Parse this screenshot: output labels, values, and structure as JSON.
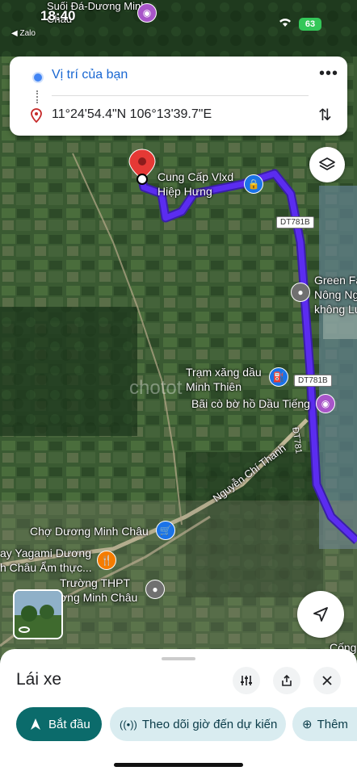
{
  "status_bar": {
    "time": "18:40",
    "back_app": "◀ Zalo",
    "battery": "63"
  },
  "route": {
    "from": "Vị trí của bạn",
    "to": "11°24'54.4\"N 106°13'39.7\"E",
    "more_icon": "more-dots-icon",
    "swap_icon": "swap-icon"
  },
  "map": {
    "places": {
      "top_poi": "Suối Đá-Dương Minh Châu",
      "destination": "Cung Cấp Vlxd Hiệp Hưng",
      "green_farm": "Green Fa Nông Ng không Lu",
      "gas_station": "Trạm xăng dầu Minh Thiên",
      "bird_park": "Bãi cò bờ hồ Dầu Tiếng",
      "market": "Chợ Dương Minh Châu",
      "restaurant": "ay Yagami Dương h Châu Ẩm thực...",
      "school": "Trường THPT ơng Minh Châu",
      "bottom_right": "Cống",
      "watermark": "chotot"
    },
    "roads": {
      "dt781b_1": "DT781B",
      "dt781b_2": "DT781B",
      "dt781": "ĐT781",
      "nguyen_chi_thanh": "Nguyễn Chí Thanh"
    }
  },
  "sheet": {
    "title": "Lái xe",
    "chips": {
      "start": "Bắt đầu",
      "track": "Theo dõi giờ đến dự kiến",
      "add": "Thêm"
    }
  },
  "colors": {
    "route": "#5b2cf0",
    "accent": "#0b6b6b",
    "chip_bg": "#d9ecf0",
    "link": "#1967d2"
  }
}
